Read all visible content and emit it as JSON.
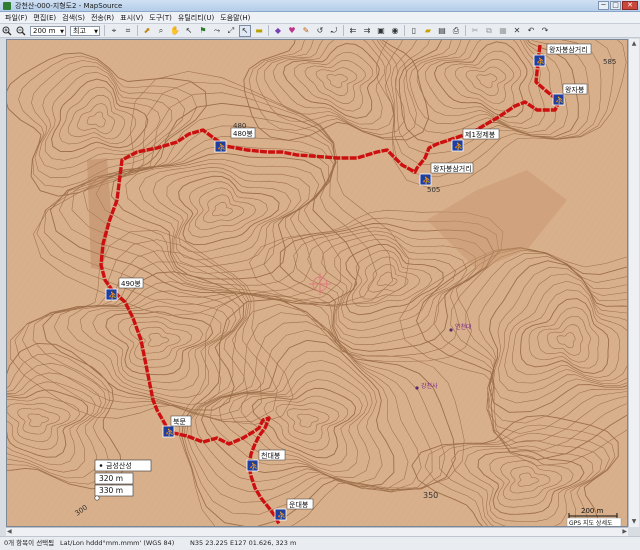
{
  "window": {
    "title": "강천산-000-지형도2 - MapSource",
    "buttons": {
      "minimize": "─",
      "maximize": "□",
      "close": "✕"
    }
  },
  "menu": [
    "파일(F)",
    "편집(E)",
    "검색(S)",
    "전송(R)",
    "표시(V)",
    "도구(T)",
    "유틸리티(U)",
    "도움말(H)"
  ],
  "toolbar": {
    "zoom_value": "200 m",
    "detail_value": "최고",
    "icons": [
      "zoom-in-icon",
      "zoom-out-icon"
    ]
  },
  "map": {
    "waypoints": {
      "p480": "480봉",
      "p490": "490봉",
      "bukmun": "북문",
      "cheondae": "천대봉",
      "undae": "운대봉",
      "crossroad": "왕자봉삼거리",
      "jeongje": "제1정제봉",
      "wangja_cross": "왕자봉삼거리",
      "wangjabong": "왕자봉"
    },
    "elevations": {
      "e480": "480",
      "e505": "505",
      "e585": "585",
      "e350": "350",
      "e300": "300"
    },
    "places": {
      "yeoncheonsa": "연천대",
      "gangcheonsa": "강천사"
    },
    "info_box": {
      "title": "금성산성",
      "row1": "320 m",
      "row2": "330 m"
    },
    "scale": {
      "label": "200 m",
      "source": "GPS 지도 상세도"
    },
    "colors": {
      "terrain": "#d9b08c",
      "contour": "#8a5a36",
      "route": "#cc1010"
    }
  },
  "status": {
    "selection": "0개 항목이 선택됨",
    "format": "Lat/Lon hddd°mm.mmm' (WGS 84)",
    "coords": "N35 23.225 E127 01.626, 323 m"
  }
}
